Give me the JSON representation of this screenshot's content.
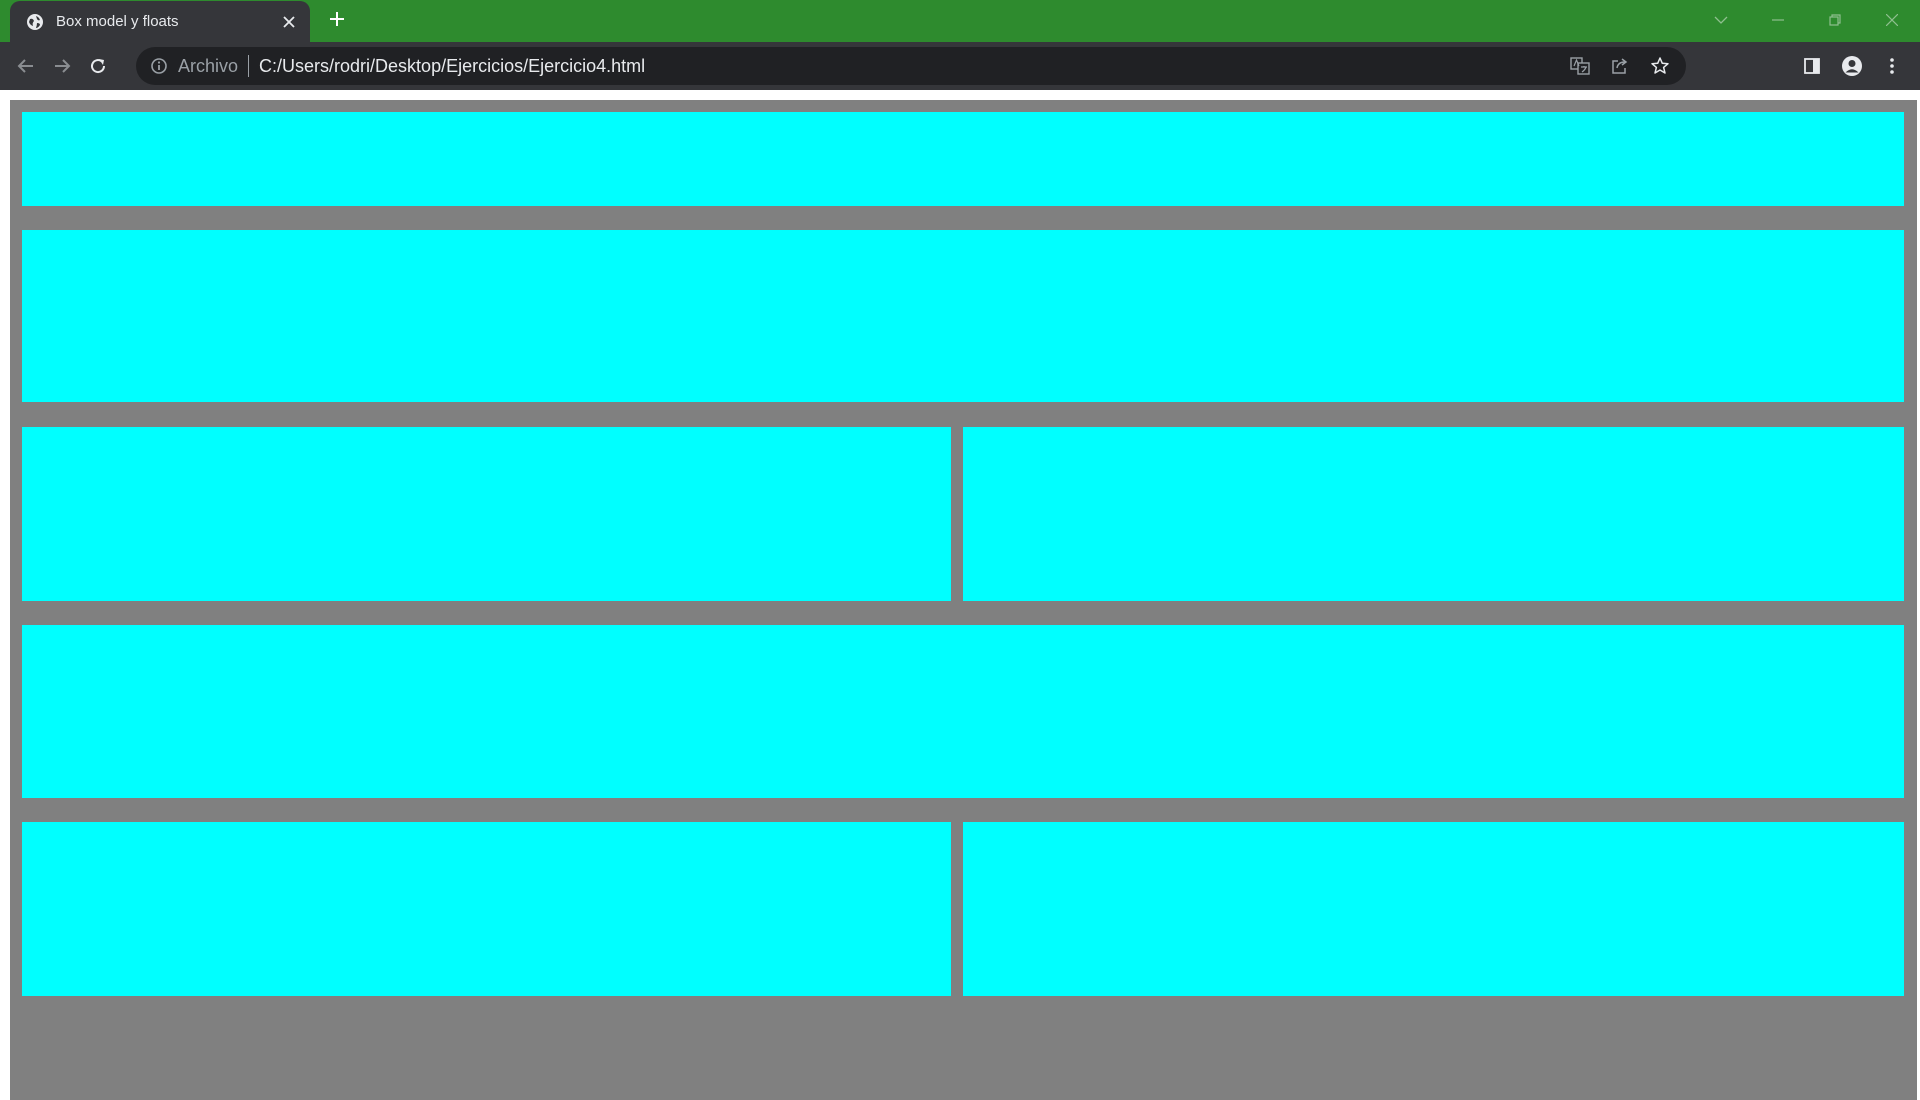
{
  "browser": {
    "tab": {
      "title": "Box model y floats",
      "favicon": "globe-icon",
      "close": "close-icon"
    },
    "new_tab": "plus-icon",
    "window_controls": [
      "chevron-down-icon",
      "minimize-icon",
      "restore-icon",
      "close-icon"
    ],
    "toolbar": {
      "back": "arrow-left-icon",
      "forward": "arrow-right-icon",
      "reload": "reload-icon"
    },
    "omnibox": {
      "info_icon": "info-icon",
      "scheme_label": "Archivo",
      "url": "C:/Users/rodri/Desktop/Ejercicios/Ejercicio4.html",
      "actions": [
        "translate-icon",
        "share-icon",
        "star-icon"
      ]
    },
    "right_tools": [
      "side-panel-icon",
      "profile-icon",
      "kebab-menu-icon"
    ],
    "colors": {
      "titlebar": "#2e8b2e",
      "tab": "#35363a",
      "toolbar": "#35363a",
      "omnibox": "#202124"
    }
  },
  "page": {
    "container_color": "#808080",
    "box_color": "#00ffff",
    "rows": [
      {
        "boxes": 1
      },
      {
        "boxes": 1
      },
      {
        "boxes": 2
      },
      {
        "boxes": 1
      },
      {
        "boxes": 2
      }
    ]
  }
}
